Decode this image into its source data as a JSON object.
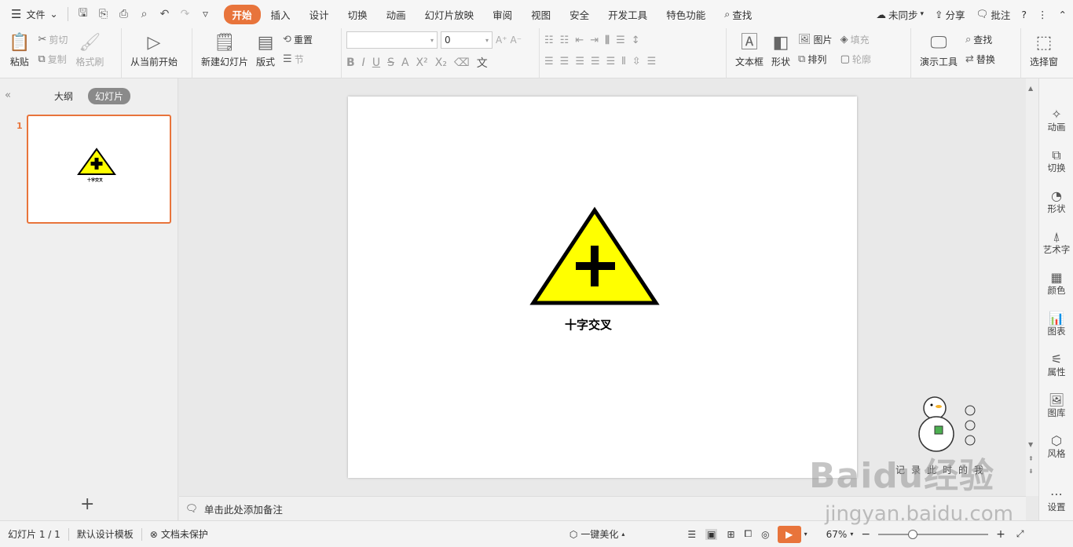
{
  "menubar": {
    "file_label": "文件",
    "tabs": [
      {
        "label": "开始",
        "active": true
      },
      {
        "label": "插入"
      },
      {
        "label": "设计"
      },
      {
        "label": "切换"
      },
      {
        "label": "动画"
      },
      {
        "label": "幻灯片放映"
      },
      {
        "label": "审阅"
      },
      {
        "label": "视图"
      },
      {
        "label": "安全"
      },
      {
        "label": "开发工具"
      },
      {
        "label": "特色功能"
      }
    ],
    "search_label": "查找",
    "sync_label": "未同步",
    "share_label": "分享",
    "comment_label": "批注",
    "help_label": "?",
    "accent_color": "#e8743b"
  },
  "ribbon": {
    "paste": "粘贴",
    "cut": "剪切",
    "copy": "复制",
    "format_painter": "格式刷",
    "from_current": "从当前开始",
    "new_slide": "新建幻灯片",
    "layout": "版式",
    "reset": "重置",
    "section": "节",
    "font_name": "",
    "font_size": "0",
    "textbox": "文本框",
    "shape": "形状",
    "picture": "图片",
    "arrange": "排列",
    "fill": "填充",
    "outline": "轮廓",
    "presentation_tools": "演示工具",
    "find": "查找",
    "replace": "替换",
    "select_pane": "选择窗"
  },
  "leftpane": {
    "tab_outline": "大纲",
    "tab_slides": "幻灯片",
    "slide_number": "1"
  },
  "slide": {
    "sign_caption": "十字交叉",
    "sign_fill_color": "#ffff00",
    "sign_border_color": "#000000",
    "thumb_caption": "十字交叉"
  },
  "notes": {
    "placeholder": "单击此处添加备注"
  },
  "rightpane": {
    "items": [
      "动画",
      "切换",
      "形状",
      "艺术字",
      "颜色",
      "图表",
      "属性",
      "图库",
      "风格",
      "设置"
    ]
  },
  "statusbar": {
    "slide_info": "幻灯片 1 / 1",
    "template": "默认设计模板",
    "protection": "文档未保护",
    "beautify": "一键美化",
    "zoom": "67%"
  },
  "watermark": {
    "brand": "Baidu经验",
    "url": "jingyan.baidu.com",
    "overlay_text": "记录此时的我"
  }
}
